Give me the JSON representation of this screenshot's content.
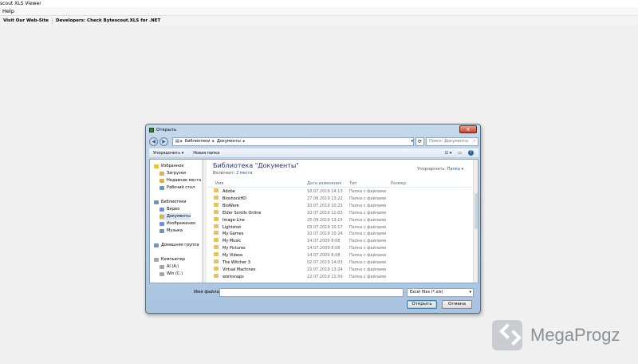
{
  "app": {
    "title": "scout XLS Viewer",
    "menu": [
      "Help"
    ],
    "links": [
      "Visit Our Web-Site",
      "Developers: Check Bytescout.XLS for .NET"
    ]
  },
  "dialog": {
    "title": "Открыть",
    "close_label": "x",
    "address_parts": [
      "Библиотеки",
      "Документы"
    ],
    "search_placeholder": "Поиск: Документы",
    "toolbar": {
      "organize": "Упорядочить ▾",
      "new_folder": "Новая папка"
    },
    "nav": [
      {
        "label": "Избранное",
        "icon": "star-icon"
      },
      {
        "label": "Загрузки",
        "icon": "folder-icon"
      },
      {
        "label": "Недавние места",
        "icon": "folder-icon"
      },
      {
        "label": "Рабочий стол",
        "icon": "folder-icon"
      },
      {
        "label": "Библиотеки",
        "icon": "library-icon"
      },
      {
        "label": "Видео",
        "icon": "folder-icon"
      },
      {
        "label": "Документы",
        "icon": "folder-icon"
      },
      {
        "label": "Изображения",
        "icon": "folder-icon"
      },
      {
        "label": "Музыка",
        "icon": "folder-icon"
      },
      {
        "label": "Домашняя группа",
        "icon": "homegroup-icon"
      },
      {
        "label": "Компьютер",
        "icon": "computer-icon"
      },
      {
        "label": "Al (A:)",
        "icon": "drive-icon"
      },
      {
        "label": "Win (C:)",
        "icon": "drive-icon"
      }
    ],
    "library": {
      "title": "Библиотека \"Документы\"",
      "includes_label": "Включает:",
      "includes_value": "2 места",
      "arrange_label": "Упорядочить:",
      "arrange_value": "Папка ▾"
    },
    "columns": [
      "Имя",
      "Дата изменения",
      "Тип",
      "Размер"
    ],
    "files": [
      {
        "name": "Adobe",
        "date": "18.07.2019 14:13",
        "type": "Папка с файлами"
      },
      {
        "name": "BioshockHD",
        "date": "27.06.2019 13:22",
        "type": "Папка с файлами"
      },
      {
        "name": "BioWare",
        "date": "10.07.2019 10:23",
        "type": "Папка с файлами"
      },
      {
        "name": "Elder Scrolls Online",
        "date": "10.07.2019 12:03",
        "type": "Папка с файлами"
      },
      {
        "name": "Image-Line",
        "date": "25.09.2019 13:15",
        "type": "Папка с файлами"
      },
      {
        "name": "Lightshot",
        "date": "03.07.2019 10:17",
        "type": "Папка с файлами"
      },
      {
        "name": "My Games",
        "date": "10.07.2019 10:24",
        "type": "Папка с файлами"
      },
      {
        "name": "My Music",
        "date": "14.07.2009 8:08",
        "type": "Папка с файлами"
      },
      {
        "name": "My Pictures",
        "date": "14.07.2009 8:08",
        "type": "Папка с файлами"
      },
      {
        "name": "My Videos",
        "date": "14.07.2009 8:08",
        "type": "Папка с файлами"
      },
      {
        "name": "The Witcher 3",
        "date": "02.07.2019 14:03",
        "type": "Папка с файлами"
      },
      {
        "name": "Virtual Machines",
        "date": "22.07.2019 13:24",
        "type": "Папка с файлами"
      },
      {
        "name": "worksnaps",
        "date": "22.07.2019 11:59",
        "type": "Папка с файлами"
      }
    ],
    "filename_label": "Имя файла:",
    "filename_value": "",
    "filetype_value": "Excel files (*.xls)",
    "open_label": "Открыть",
    "cancel_label": "Отмена"
  },
  "watermark": {
    "text": "MegaProgz"
  }
}
